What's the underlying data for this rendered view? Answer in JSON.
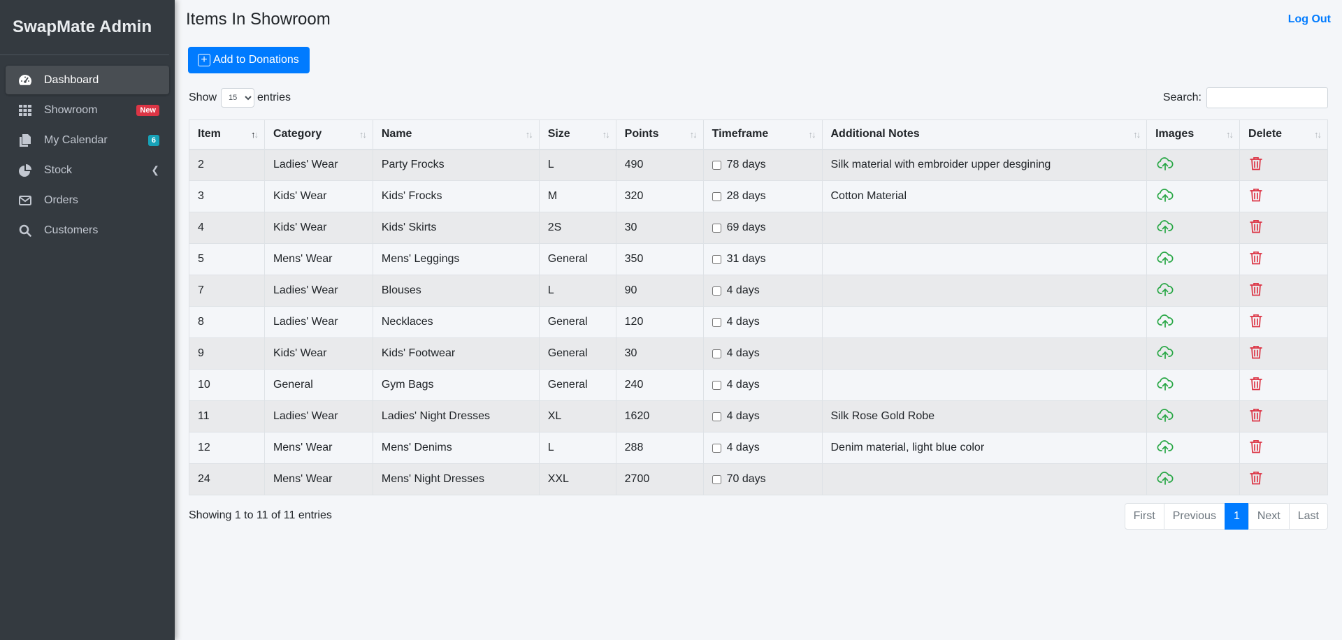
{
  "sidebar": {
    "brand": "SwapMate Admin",
    "items": [
      {
        "label": "Dashboard",
        "icon": "dashboard-gauge-icon"
      },
      {
        "label": "Showroom",
        "icon": "grid-icon",
        "badge": "New"
      },
      {
        "label": "My Calendar",
        "icon": "copy-pages-icon",
        "badge": "6"
      },
      {
        "label": "Stock",
        "icon": "pie-chart-icon"
      },
      {
        "label": "Orders",
        "icon": "envelope-icon"
      },
      {
        "label": "Customers",
        "icon": "search-icon"
      }
    ]
  },
  "header": {
    "title": "Items In Showroom",
    "logout": "Log Out"
  },
  "toolbar": {
    "add_label": "Add to Donations",
    "show_label": "Show",
    "entries_label": "entries",
    "page_length": "15",
    "search_label": "Search:",
    "search_value": ""
  },
  "table": {
    "columns": [
      "Item",
      "Category",
      "Name",
      "Size",
      "Points",
      "Timeframe",
      "Additional Notes",
      "Images",
      "Delete"
    ],
    "rows": [
      {
        "item": "2",
        "category": "Ladies' Wear",
        "name": "Party Frocks",
        "size": "L",
        "points": "490",
        "timeframe": "78 days",
        "notes": "Silk material with embroider upper desgining"
      },
      {
        "item": "3",
        "category": "Kids' Wear",
        "name": "Kids' Frocks",
        "size": "M",
        "points": "320",
        "timeframe": "28 days",
        "notes": "Cotton Material"
      },
      {
        "item": "4",
        "category": "Kids' Wear",
        "name": "Kids' Skirts",
        "size": "2S",
        "points": "30",
        "timeframe": "69 days",
        "notes": ""
      },
      {
        "item": "5",
        "category": "Mens' Wear",
        "name": "Mens' Leggings",
        "size": "General",
        "points": "350",
        "timeframe": "31 days",
        "notes": ""
      },
      {
        "item": "7",
        "category": "Ladies' Wear",
        "name": "Blouses",
        "size": "L",
        "points": "90",
        "timeframe": "4 days",
        "notes": ""
      },
      {
        "item": "8",
        "category": "Ladies' Wear",
        "name": "Necklaces",
        "size": "General",
        "points": "120",
        "timeframe": "4 days",
        "notes": ""
      },
      {
        "item": "9",
        "category": "Kids' Wear",
        "name": "Kids' Footwear",
        "size": "General",
        "points": "30",
        "timeframe": "4 days",
        "notes": ""
      },
      {
        "item": "10",
        "category": "General",
        "name": "Gym Bags",
        "size": "General",
        "points": "240",
        "timeframe": "4 days",
        "notes": ""
      },
      {
        "item": "11",
        "category": "Ladies' Wear",
        "name": "Ladies' Night Dresses",
        "size": "XL",
        "points": "1620",
        "timeframe": "4 days",
        "notes": "Silk Rose Gold Robe"
      },
      {
        "item": "12",
        "category": "Mens' Wear",
        "name": "Mens' Denims",
        "size": "L",
        "points": "288",
        "timeframe": "4 days",
        "notes": "Denim material, light blue color"
      },
      {
        "item": "24",
        "category": "Mens' Wear",
        "name": "Mens' Night Dresses",
        "size": "XXL",
        "points": "2700",
        "timeframe": "70 days",
        "notes": ""
      }
    ]
  },
  "footer": {
    "info": "Showing 1 to 11 of 11 entries",
    "pages": [
      "First",
      "Previous",
      "1",
      "Next",
      "Last"
    ],
    "current_page": "1"
  },
  "colors": {
    "primary": "#007bff",
    "sidebar_bg": "#343a40",
    "upload_icon": "#28a745",
    "delete_icon": "#dc3545"
  }
}
